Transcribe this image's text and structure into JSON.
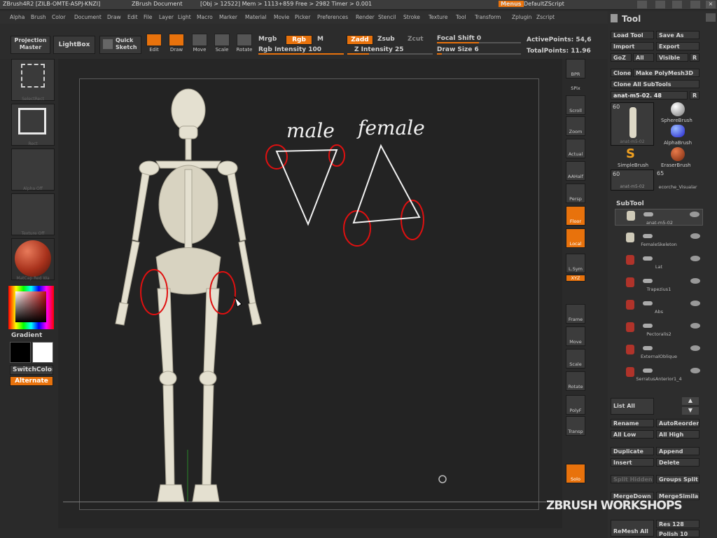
{
  "titlebar": {
    "app": "ZBrush4R2 [ZILB-OMTE-ASPJ-KNZI]",
    "doc": "ZBrush Document",
    "stats": "[Obj > 12522] Mem > 1113+859 Free > 2982 Timer > 0.001",
    "menus": "Menus",
    "script": "DefaultZScript"
  },
  "menubar": [
    "Alpha",
    "Brush",
    "Color",
    "Document",
    "Draw",
    "Edit",
    "File",
    "Layer",
    "Light",
    "Macro",
    "Marker",
    "Material",
    "Movie",
    "Picker",
    "Preferences",
    "Render",
    "Stencil",
    "Stroke",
    "Texture",
    "Tool",
    "Transform",
    "Zplugin",
    "Zscript"
  ],
  "top": {
    "projection_master": "Projection Master",
    "lightbox": "LightBox",
    "quick_sketch": "Quick Sketch",
    "edit": "Edit",
    "draw": "Draw",
    "move": "Move",
    "scale": "Scale",
    "rotate": "Rotate",
    "mrgb": "Mrgb",
    "rgb": "Rgb",
    "m": "M",
    "rgb_intensity": "Rgb Intensity 100",
    "zadd": "Zadd",
    "zsub": "Zsub",
    "zcut": "Zcut",
    "z_intensity": "Z Intensity 25",
    "focal_shift": "Focal Shift 0",
    "draw_size": "Draw Size 6",
    "active_points": "ActivePoints: 54,6",
    "total_points": "TotalPoints: 11.96",
    "rgb_intensity_value": 1.0,
    "z_intensity_value": 0.25,
    "focal_value": 0.5,
    "draw_size_value": 0.06
  },
  "left": {
    "select_rect": "SelectRect",
    "rect": "Rect",
    "alpha_off": "Alpha Off",
    "texture_off": "Texture Off",
    "matcap": "MatCap Red Wa",
    "gradient": "Gradient",
    "switch_color": "SwitchColor",
    "alternate": "Alternate"
  },
  "annotations": {
    "male": "male",
    "female": "female"
  },
  "shelf": [
    "BPR",
    "SPix",
    "Scroll",
    "Zoom",
    "Actual",
    "AAHalf",
    "Persp",
    "Floor",
    "Local",
    "L.Sym",
    "Frame",
    "Move",
    "Scale",
    "Rotate",
    "PolyF",
    "Transp",
    "Solo"
  ],
  "shelf_xyz": "XYZ",
  "toolpanel": {
    "title": "Tool",
    "load_tool": "Load Tool",
    "save_as": "Save As",
    "import": "Import",
    "export": "Export",
    "goz": "GoZ",
    "all": "All",
    "visible": "Visible",
    "r": "R",
    "clone": "Clone",
    "make_polymesh": "Make PolyMesh3D",
    "clone_all": "Clone All SubTools",
    "current_tool": "anat-m5-02. 48",
    "tool_count1": "60",
    "tool_name1": "anat-m5-02",
    "sphere_brush": "SphereBrush",
    "alpha_brush": "AlphaBrush",
    "simple_brush": "SimpleBrush",
    "eraser_brush": "EraserBrush",
    "tool_count2": "60",
    "tool_count3": "65",
    "thumb_name2": "anat-m5-02",
    "thumb_name3": "ecorche_Visualar",
    "subtool_title": "SubTool",
    "subtools": [
      "anat-m5-02",
      "FemaleSkeleton",
      "Lat",
      "Trapezius1",
      "Abs",
      "Pectoralis2",
      "ExternalOblique",
      "SerratusAnterior1_4"
    ],
    "list_all": "List All",
    "rename": "Rename",
    "auto_reorder": "AutoReorder",
    "all_low": "All Low",
    "all_high": "All High",
    "duplicate": "Duplicate",
    "append": "Append",
    "insert": "Insert",
    "delete": "Delete",
    "split_hidden": "Split Hidden",
    "groups_split": "Groups Split",
    "merge_down": "MergeDown",
    "merge_similar": "MergeSimilar",
    "remesh_all": "ReMesh All",
    "res": "Res 128",
    "polish": "Polish 10"
  },
  "watermark": "ZBRUSH WORKSHOPS",
  "colors": {
    "accent": "#e8720c",
    "annotation": "#e01010"
  }
}
